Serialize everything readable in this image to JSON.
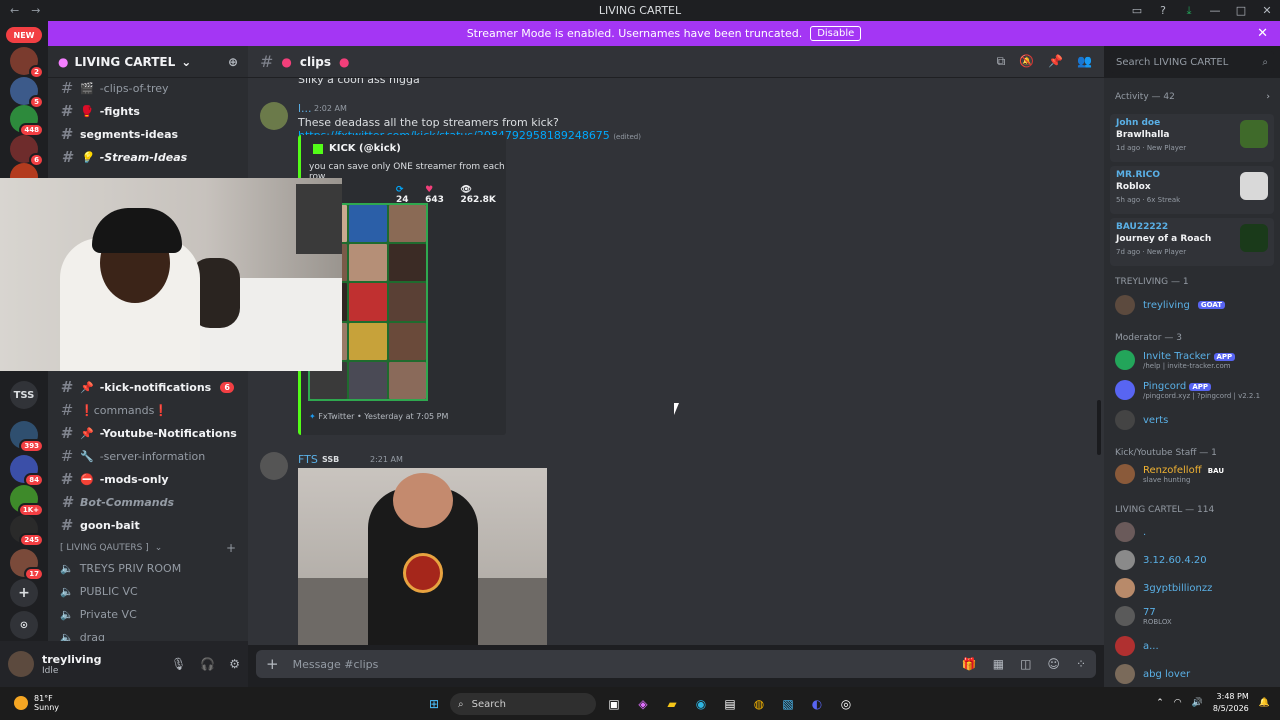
{
  "window": {
    "title": "LIVING CARTEL"
  },
  "banner": {
    "text": "Streamer Mode is enabled. Usernames have been truncated.",
    "button": "Disable"
  },
  "servers": {
    "new_label": "NEW",
    "badges": [
      "2",
      "5",
      "448",
      "6",
      "393",
      "84",
      "1K+",
      "245",
      "17"
    ],
    "tss_label": "TSS"
  },
  "guild": {
    "name": "LIVING CARTEL"
  },
  "channels": {
    "items": [
      {
        "name": "-clips-of-trey",
        "icon": "🎬"
      },
      {
        "name": "-fights",
        "icon": "🥊"
      },
      {
        "name": "segments-ideas",
        "icon": ""
      },
      {
        "name": "-Stream-Ideas",
        "icon": "💡"
      },
      {
        "name": "-kick-notifications",
        "icon": "📌",
        "count": "6"
      },
      {
        "name": "❗commands❗",
        "icon": "❗"
      },
      {
        "name": "-Youtube-Notifications",
        "icon": "📌"
      },
      {
        "name": "-server-information",
        "icon": "🔧"
      },
      {
        "name": "-mods-only",
        "icon": "⛔"
      },
      {
        "name": "Bot-Commands",
        "icon": ""
      },
      {
        "name": "goon-bait",
        "icon": ""
      }
    ],
    "category": "[ LIVING QAUTERS ]",
    "voice": [
      "TREYS PRIV ROOM",
      "PUBLIC VC",
      "Private VC",
      "drag"
    ]
  },
  "user": {
    "name": "treyliving",
    "status": "Idle"
  },
  "chat_header": {
    "channel": "clips"
  },
  "search": {
    "placeholder": "Search LIVING CARTEL"
  },
  "messages": {
    "m0": {
      "text": "Silky a coon ass nigga"
    },
    "m1": {
      "author": "l...",
      "time": "2:02 AM",
      "text": "These deadass all the top streamers from kick?",
      "link": "https://fxtwitter.com/kick/status/2084792958189248675",
      "edited": "(edited)"
    },
    "embed": {
      "author": "KICK (@kick)",
      "desc": "you can save only ONE streamer from each row",
      "replies": "24",
      "likes": "643",
      "views": "262.8K",
      "footer": "FxTwitter • Yesterday at 7:05 PM"
    },
    "m2": {
      "author": "FTS",
      "tag": "SSB",
      "time": "2:21 AM"
    }
  },
  "input": {
    "placeholder": "Message #clips"
  },
  "members": {
    "activity_header": "Activity — 42",
    "cards": [
      {
        "name": "John doe",
        "game": "Brawlhalla",
        "meta": "1d ago · New Player"
      },
      {
        "name": "MR.RICO",
        "game": "Roblox",
        "meta": "5h ago · 6x Streak"
      },
      {
        "name": "BAU22222",
        "game": "Journey of a Roach",
        "meta": "7d ago · New Player"
      }
    ],
    "sections": [
      {
        "label": "TREYLIVING — 1"
      },
      {
        "label": "Moderator — 3"
      },
      {
        "label": "Kick/Youtube Staff — 1"
      },
      {
        "label": "LIVING CARTEL — 114"
      }
    ],
    "treyliving": {
      "name": "treyliving",
      "tag": "GOAT"
    },
    "mods": [
      {
        "name": "Invite Tracker",
        "tag": "APP",
        "sub": "/help | invite-tracker.com"
      },
      {
        "name": "Pingcord",
        "tag": "APP",
        "sub": "/pingcord.xyz | ?pingcord | v2.2.1"
      },
      {
        "name": "verts",
        "tag": "",
        "sub": ""
      }
    ],
    "staff": {
      "name": "Renzofelloff",
      "tag": "BAU",
      "sub": "slave hunting"
    },
    "list": [
      {
        "name": "."
      },
      {
        "name": "3.12.60.4.20"
      },
      {
        "name": "3gyptbillionzz"
      },
      {
        "name": "77",
        "sub": "ROBLOX"
      },
      {
        "name": "a..."
      },
      {
        "name": "abg lover"
      }
    ]
  },
  "taskbar": {
    "temp": "81°F",
    "weather": "Sunny",
    "search": "Search",
    "time": "3:48 PM",
    "date": "8/5/2026"
  }
}
